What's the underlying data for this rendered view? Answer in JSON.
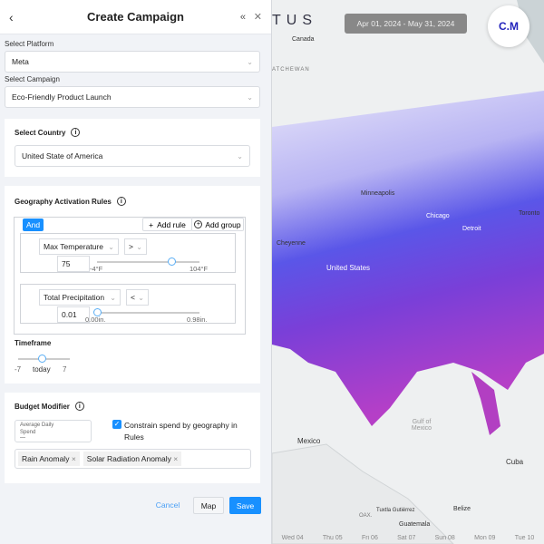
{
  "panel": {
    "title": "Create Campaign",
    "platform_label": "Select Platform",
    "platform_value": "Meta",
    "campaign_label": "Select Campaign",
    "campaign_value": "Eco-Friendly Product Launch",
    "country_title": "Select Country",
    "country_value": "United State of America",
    "rules_title": "Geography Activation Rules",
    "and_label": "And",
    "add_rule": "Add rule",
    "add_group": "Add group",
    "rules": [
      {
        "metric": "Max Temperature",
        "op": ">",
        "value": "75",
        "min": "-4°F",
        "max": "104°F",
        "fraction": 0.73
      },
      {
        "metric": "Total Precipitation",
        "op": "<",
        "value": "0.01",
        "min": "0.00in.",
        "max": "0.98in.",
        "fraction": 0.0
      }
    ],
    "timeframe_title": "Timeframe",
    "tf_min": "-7",
    "tf_mid": "today",
    "tf_max": "7",
    "budget_title": "Budget Modifier",
    "avg_label": "Average Daily Spend",
    "avg_value": "---",
    "constrain_label": "Constrain spend by geography in Rules",
    "constrain_checked": true,
    "tags": [
      "Rain Anomaly",
      "Solar Radiation Anomaly"
    ],
    "cancel": "Cancel",
    "map": "Map",
    "save": "Save"
  },
  "map": {
    "logo": "TUS",
    "date_range": "Apr 01, 2024 - May 31, 2024",
    "avatar": "C.M",
    "labels": [
      "Canada",
      "ATCHEWAN",
      "United States",
      "Mexico",
      "Cuba",
      "Guatemala",
      "Gulf of Mexico",
      "Minneapolis",
      "Chicago",
      "Detroit",
      "Cheyenne",
      "Toronto",
      "Belize",
      "Tuxtla Gutiérrez",
      "OAX."
    ],
    "timeline": [
      "Wed 04",
      "Thu 05",
      "Fri 06",
      "Sat 07",
      "Sun 08",
      "Mon 09",
      "Tue 10"
    ]
  },
  "colors": {
    "accent": "#1890ff",
    "avatar_text": "#2222bb"
  }
}
